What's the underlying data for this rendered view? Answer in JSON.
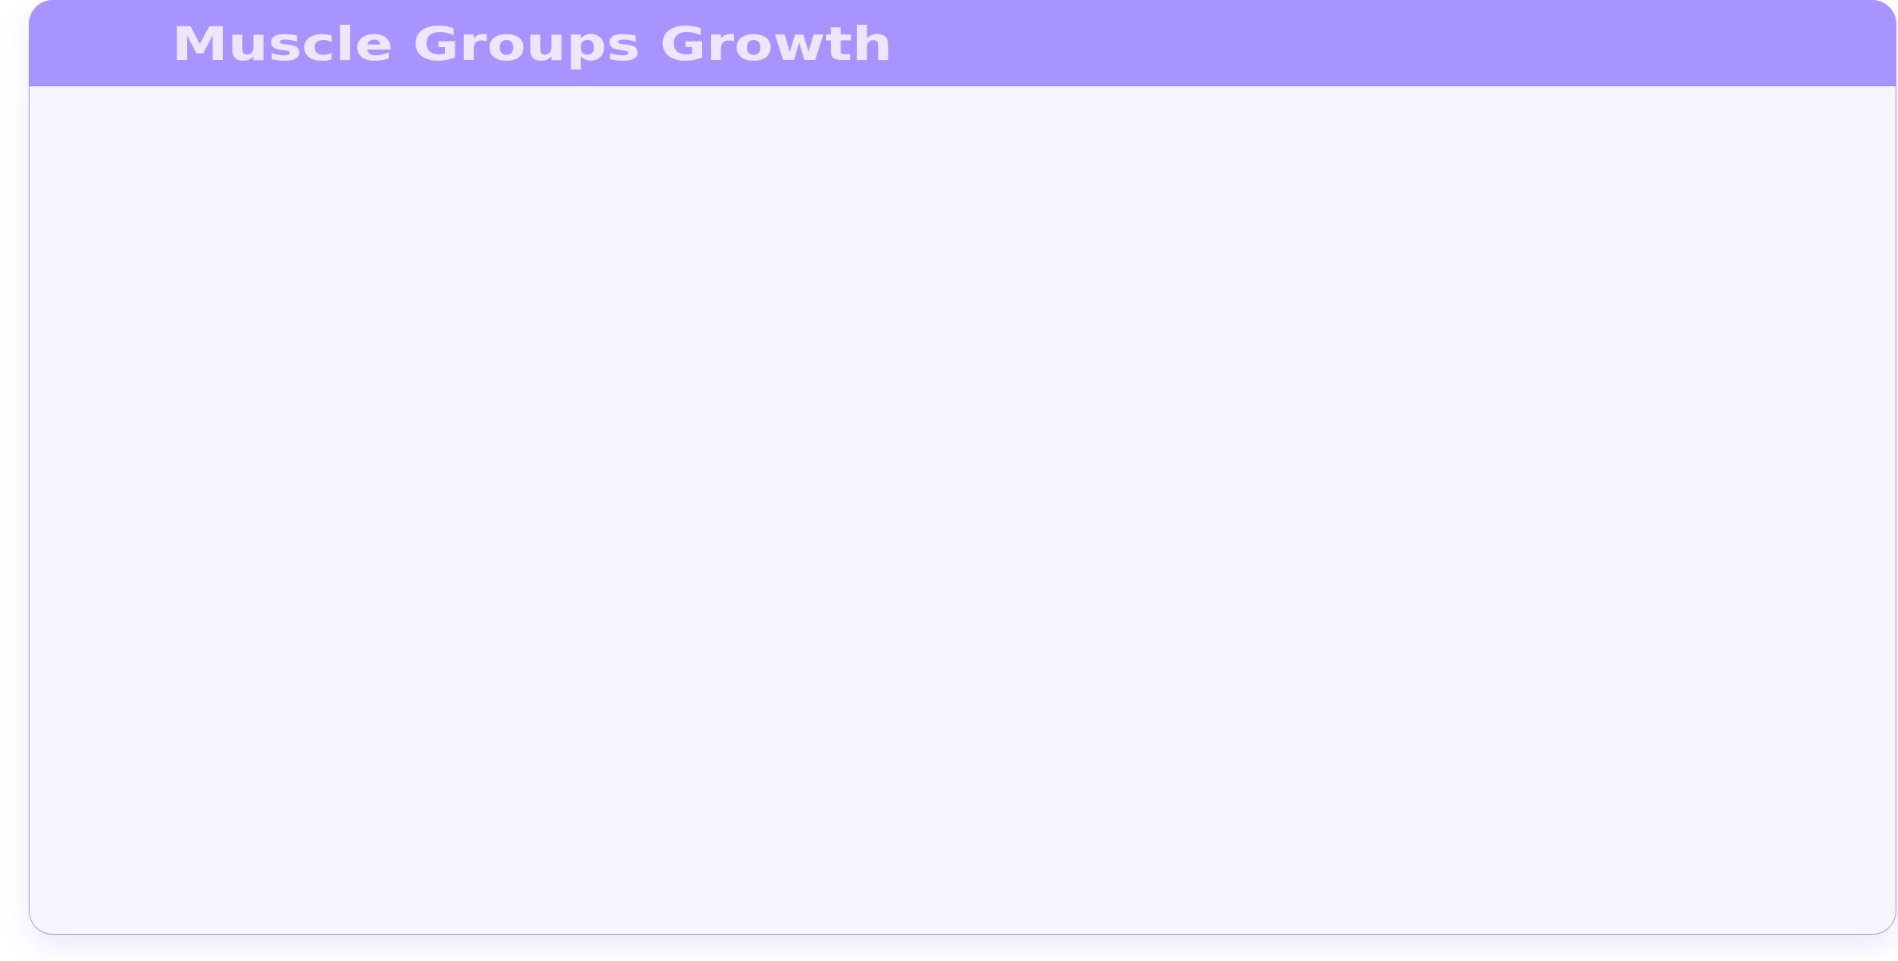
{
  "card": {
    "title": "Muscle Groups Growth"
  },
  "colors": {
    "header_background": "#a894ff",
    "title_text": "#ece7ff",
    "card_background": "#f7f5fe",
    "card_border": "#a394f2"
  }
}
